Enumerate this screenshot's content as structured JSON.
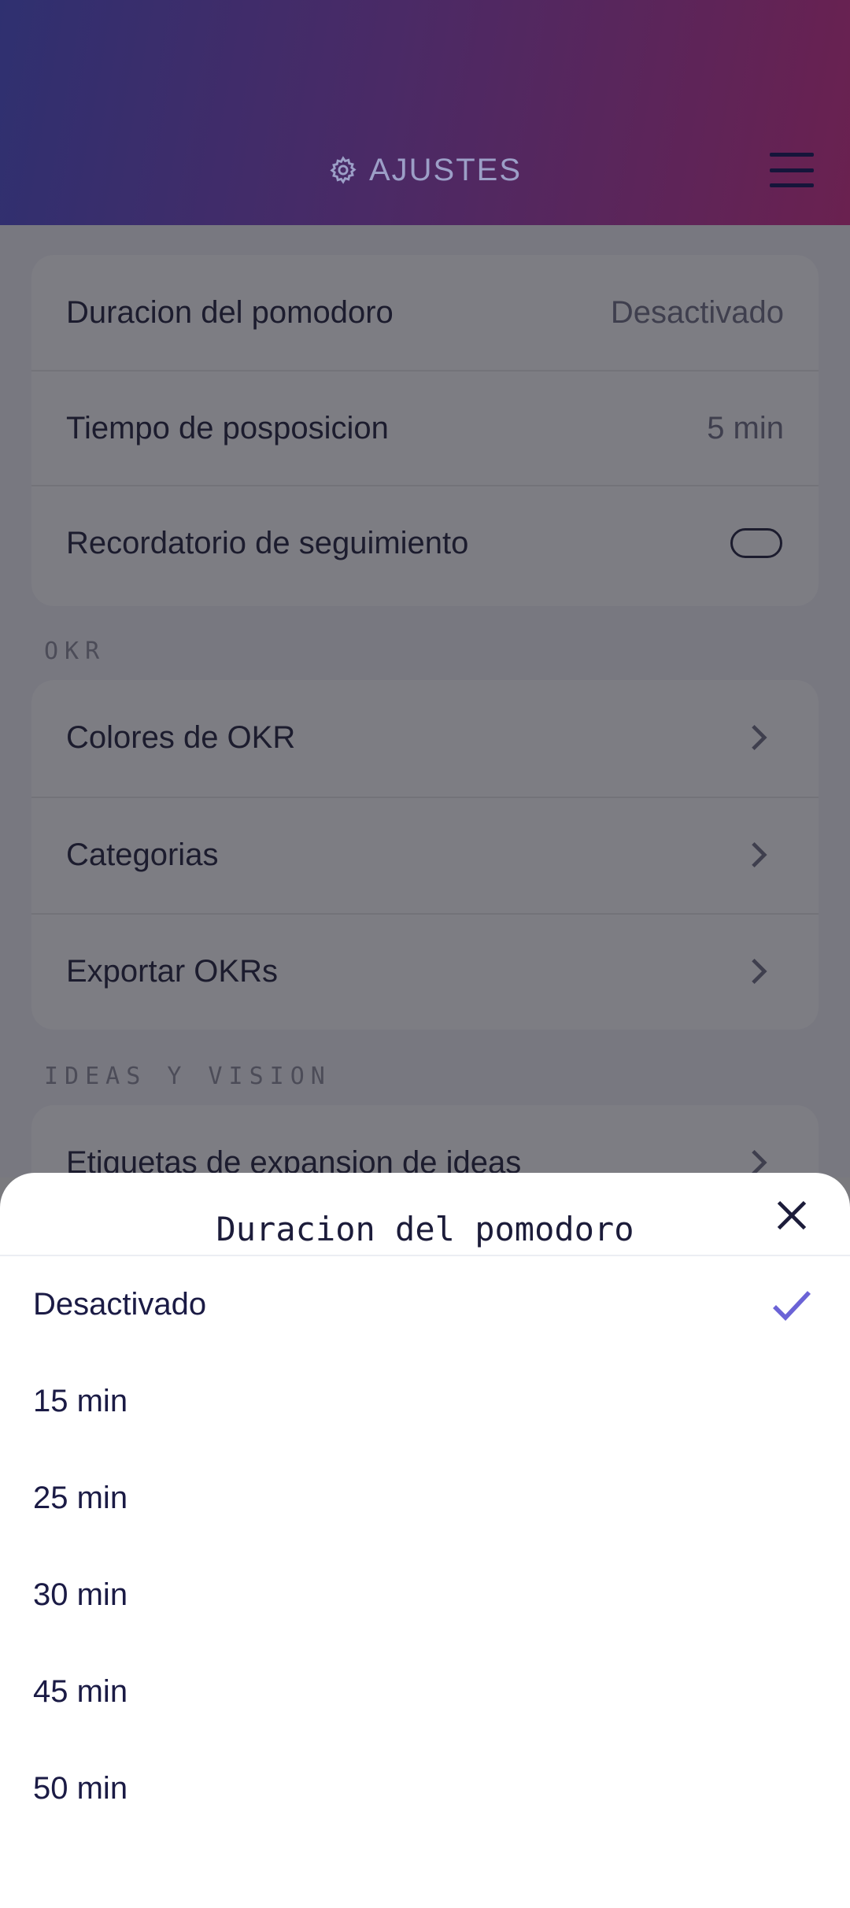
{
  "header": {
    "title": "AJUSTES",
    "title_icon": "gear-icon",
    "menu_icon": "menu-icon"
  },
  "settings": {
    "timing_rows": [
      {
        "label": "Duracion del pomodoro",
        "value": "Desactivado"
      },
      {
        "label": "Tiempo de posposicion",
        "value": "5 min"
      },
      {
        "label": "Recordatorio de seguimiento",
        "toggle": false
      }
    ],
    "okr_section": "OKR",
    "okr_rows": [
      {
        "label": "Colores de OKR"
      },
      {
        "label": "Categorias"
      },
      {
        "label": "Exportar OKRs"
      }
    ],
    "ideas_section": "IDEAS Y VISION",
    "ideas_rows": [
      {
        "label": "Etiquetas de expansion de ideas"
      }
    ]
  },
  "sheet": {
    "title": "Duracion del pomodoro",
    "close_icon": "close-icon",
    "selected": "Desactivado",
    "options": [
      "Desactivado",
      "15 min",
      "25 min",
      "30 min",
      "45 min",
      "50 min"
    ]
  },
  "colors": {
    "accent": "#6b63d6",
    "header_start": "#2f3070",
    "header_end": "#6a2150"
  }
}
